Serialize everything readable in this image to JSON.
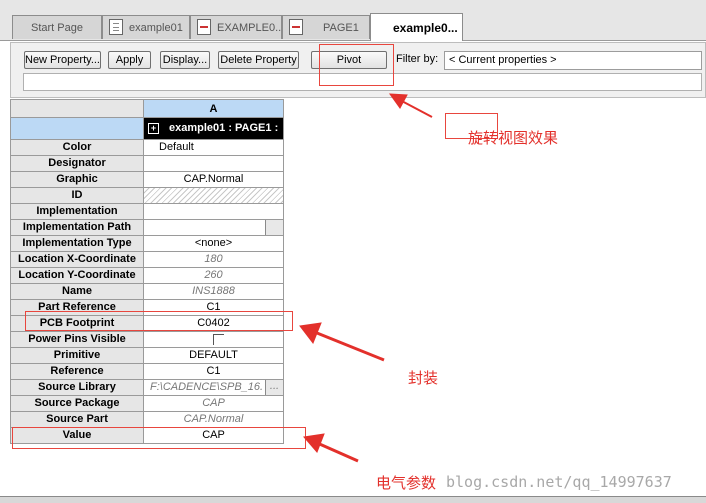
{
  "tabs": [
    {
      "label": "Start Page",
      "icon": "none"
    },
    {
      "label": "example01",
      "icon": "grid-doc-icon"
    },
    {
      "label": "EXAMPLE0...",
      "icon": "schematic-doc-icon"
    },
    {
      "label": "PAGE1",
      "icon": "schematic-doc-icon"
    },
    {
      "label": "example0...",
      "icon": "none",
      "active": true
    }
  ],
  "toolbar": {
    "new_property": "New Property...",
    "apply": "Apply",
    "display": "Display...",
    "delete_property": "Delete Property",
    "pivot": "Pivot",
    "filter_label": "Filter by:",
    "filter_value": "< Current properties >"
  },
  "grid": {
    "column_header": "A",
    "part_header": "example01 : PAGE1 :",
    "rows": [
      {
        "name": "Color",
        "value": "Default",
        "style": "left"
      },
      {
        "name": "Designator",
        "value": "",
        "style": "normal"
      },
      {
        "name": "Graphic",
        "value": "CAP.Normal",
        "style": "normal"
      },
      {
        "name": "ID",
        "value": "",
        "style": "hatch"
      },
      {
        "name": "Implementation",
        "value": "",
        "style": "normal"
      },
      {
        "name": "Implementation Path",
        "value": "",
        "style": "button"
      },
      {
        "name": "Implementation Type",
        "value": "<none>",
        "style": "normal"
      },
      {
        "name": "Location X-Coordinate",
        "value": "180",
        "style": "gray"
      },
      {
        "name": "Location Y-Coordinate",
        "value": "260",
        "style": "gray"
      },
      {
        "name": "Name",
        "value": "INS1888",
        "style": "gray"
      },
      {
        "name": "Part Reference",
        "value": "C1",
        "style": "normal"
      },
      {
        "name": "PCB Footprint",
        "value": "C0402",
        "style": "normal"
      },
      {
        "name": "Power Pins Visible",
        "value": "",
        "style": "checkbox"
      },
      {
        "name": "Primitive",
        "value": "DEFAULT",
        "style": "normal"
      },
      {
        "name": "Reference",
        "value": "C1",
        "style": "normal"
      },
      {
        "name": "Source Library",
        "value": "F:\\CADENCE\\SPB_16.",
        "style": "gray-button"
      },
      {
        "name": "Source Package",
        "value": "CAP",
        "style": "gray"
      },
      {
        "name": "Source Part",
        "value": "CAP.Normal",
        "style": "gray"
      },
      {
        "name": "Value",
        "value": "CAP",
        "style": "normal"
      }
    ]
  },
  "annotations": {
    "pivot_note": "旋转视图效果",
    "footprint_note": "封装",
    "value_note": "电气参数"
  },
  "watermark": "blog.csdn.net/qq_14997637",
  "colors": {
    "annotation_red": "#e3302b",
    "part_header_bg": "#000000",
    "column_header_bg": "#bcd9f5"
  }
}
